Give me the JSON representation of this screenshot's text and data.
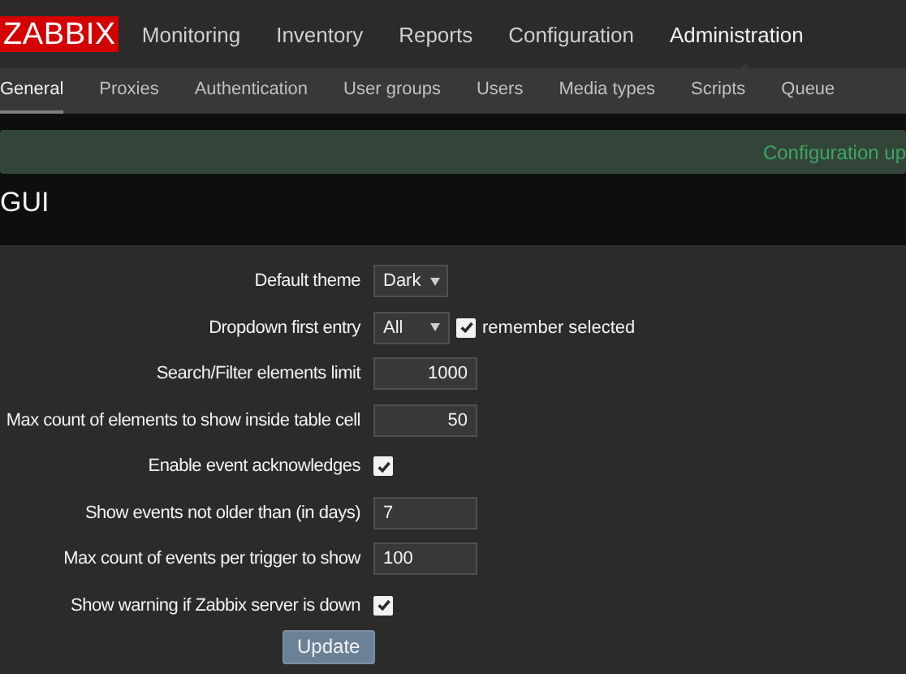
{
  "logo": "ZABBIX",
  "main_menu": [
    {
      "label": "Monitoring",
      "selected": false
    },
    {
      "label": "Inventory",
      "selected": false
    },
    {
      "label": "Reports",
      "selected": false
    },
    {
      "label": "Configuration",
      "selected": false
    },
    {
      "label": "Administration",
      "selected": true
    }
  ],
  "sub_menu": [
    {
      "label": "General",
      "selected": true
    },
    {
      "label": "Proxies",
      "selected": false
    },
    {
      "label": "Authentication",
      "selected": false
    },
    {
      "label": "User groups",
      "selected": false
    },
    {
      "label": "Users",
      "selected": false
    },
    {
      "label": "Media types",
      "selected": false
    },
    {
      "label": "Scripts",
      "selected": false
    },
    {
      "label": "Queue",
      "selected": false
    }
  ],
  "message": "Configuration up",
  "page_title": "GUI",
  "form": [
    {
      "label": "Default theme",
      "kind": "select",
      "value": "Dark"
    },
    {
      "label": "Dropdown first entry",
      "kind": "select",
      "value": "All",
      "extra": {
        "label": "remember selected",
        "checked": true
      }
    },
    {
      "label": "Search/Filter elements limit",
      "kind": "number",
      "value": "1000"
    },
    {
      "label": "Max count of elements to show inside table cell",
      "kind": "number",
      "value": "50"
    },
    {
      "label": "Enable event acknowledges",
      "kind": "checkbox",
      "checked": true
    },
    {
      "label": "Show events not older than (in days)",
      "kind": "text",
      "value": "7"
    },
    {
      "label": "Max count of events per trigger to show",
      "kind": "text",
      "value": "100"
    },
    {
      "label": "Show warning if Zabbix server is down",
      "kind": "checkbox",
      "checked": true
    }
  ],
  "submit": "Update"
}
